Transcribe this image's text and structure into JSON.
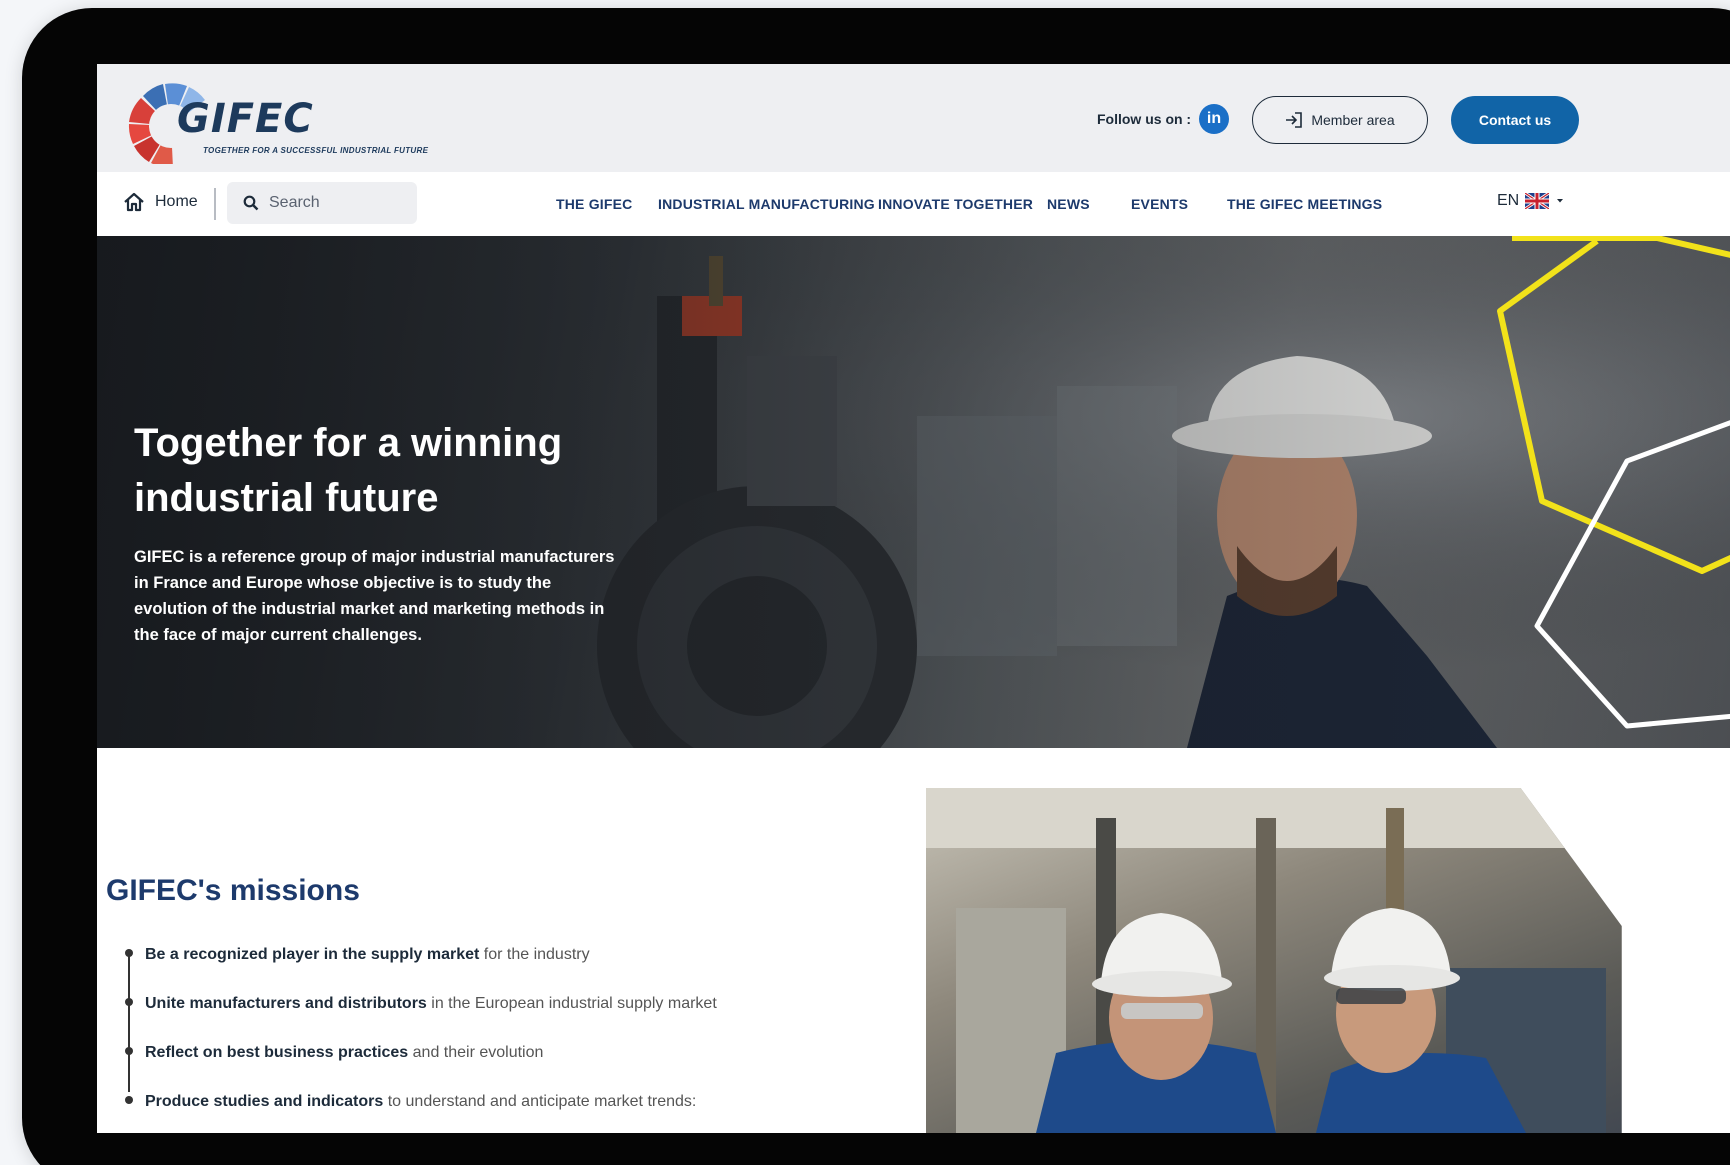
{
  "header": {
    "logo_text": "GIFEC",
    "logo_tagline": "TOGETHER FOR A SUCCESSFUL INDUSTRIAL FUTURE",
    "follow_label": "Follow us on :",
    "linkedin_label": "in",
    "member_area_label": "Member area",
    "contact_label": "Contact us"
  },
  "nav": {
    "home_label": "Home",
    "search_placeholder": "Search",
    "items": [
      "THE GIFEC",
      "INDUSTRIAL MANUFACTURING",
      "INNOVATE TOGETHER",
      "NEWS",
      "EVENTS",
      "THE GIFEC MEETINGS"
    ],
    "language": "EN"
  },
  "hero": {
    "title": "Together for a winning industrial future",
    "description": "GIFEC is a reference group of major industrial manufacturers in France and Europe whose objective is to study the evolution of the industrial market and marketing methods in the face of major current challenges."
  },
  "missions": {
    "title": "GIFEC's missions",
    "items": [
      {
        "bold": "Be a recognized player in the supply market",
        "rest": " for the industry"
      },
      {
        "bold": "Unite manufacturers and distributors",
        "rest": " in the European industrial supply market"
      },
      {
        "bold": "Reflect on best business practices",
        "rest": " and their evolution"
      },
      {
        "bold": "Produce studies and indicators",
        "rest": " to understand and anticipate market trends:"
      }
    ]
  },
  "colors": {
    "brand_navy": "#1d3a6c",
    "contact_button": "#1164a7",
    "linkedin": "#1a6fc7",
    "hex_yellow": "#f2e21a"
  }
}
